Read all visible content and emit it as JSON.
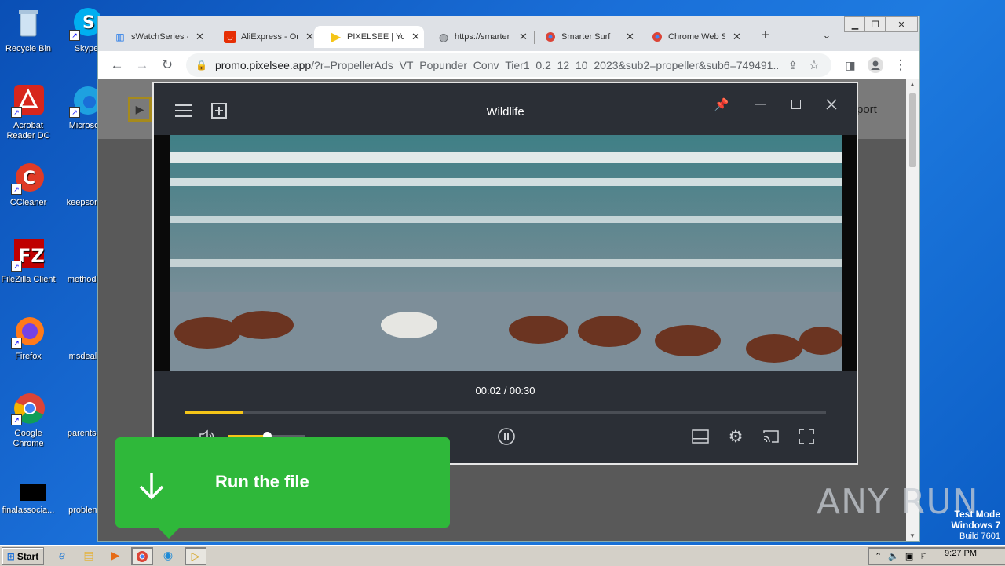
{
  "desktop": {
    "icons": [
      {
        "label": "Recycle Bin"
      },
      {
        "label": "Skype"
      },
      {
        "label": "Acrobat Reader DC"
      },
      {
        "label": "Microsoft"
      },
      {
        "label": "CCleaner"
      },
      {
        "label": "keepsome"
      },
      {
        "label": "FileZilla Client"
      },
      {
        "label": "methodsp"
      },
      {
        "label": "Firefox"
      },
      {
        "label": "msdeal.p"
      },
      {
        "label": "Google Chrome"
      },
      {
        "label": "parentsca"
      },
      {
        "label": "finalassocia..."
      },
      {
        "label": "problemd"
      }
    ]
  },
  "browser": {
    "tabs": [
      {
        "title": "sWatchSeries -",
        "icon": "swatch-icon",
        "color": "#1a73e8"
      },
      {
        "title": "AliExpress - Or",
        "icon": "aliexpress-icon",
        "color": "#e62e04"
      },
      {
        "title": "PIXELSEE | You",
        "icon": "pixelsee-icon",
        "color": "#f5c518"
      },
      {
        "title": "https://smarter",
        "icon": "globe-icon",
        "color": "#5f6368"
      },
      {
        "title": "Smarter Surf",
        "icon": "chrome-icon",
        "color": "#4285f4"
      },
      {
        "title": "Chrome Web S",
        "icon": "chrome-icon",
        "color": "#4285f4"
      }
    ],
    "url_host": "promo.pixelsee.app",
    "url_rest": "/?r=PropellerAds_VT_Popunder_Conv_Tier1_0.2_12_10_2023&sub2=propeller&sub6=749491...",
    "page_support": "port"
  },
  "player": {
    "title": "Wildlife",
    "time": "00:02 / 00:30",
    "progress": 0.09,
    "volume": 0.5
  },
  "banner": {
    "text": "Run the file"
  },
  "watermark": {
    "text": "ANY RUN",
    "test_mode": "Test Mode",
    "os": "Windows 7",
    "build": "Build 7601"
  },
  "taskbar": {
    "start": "Start",
    "clock": "9:27 PM"
  }
}
